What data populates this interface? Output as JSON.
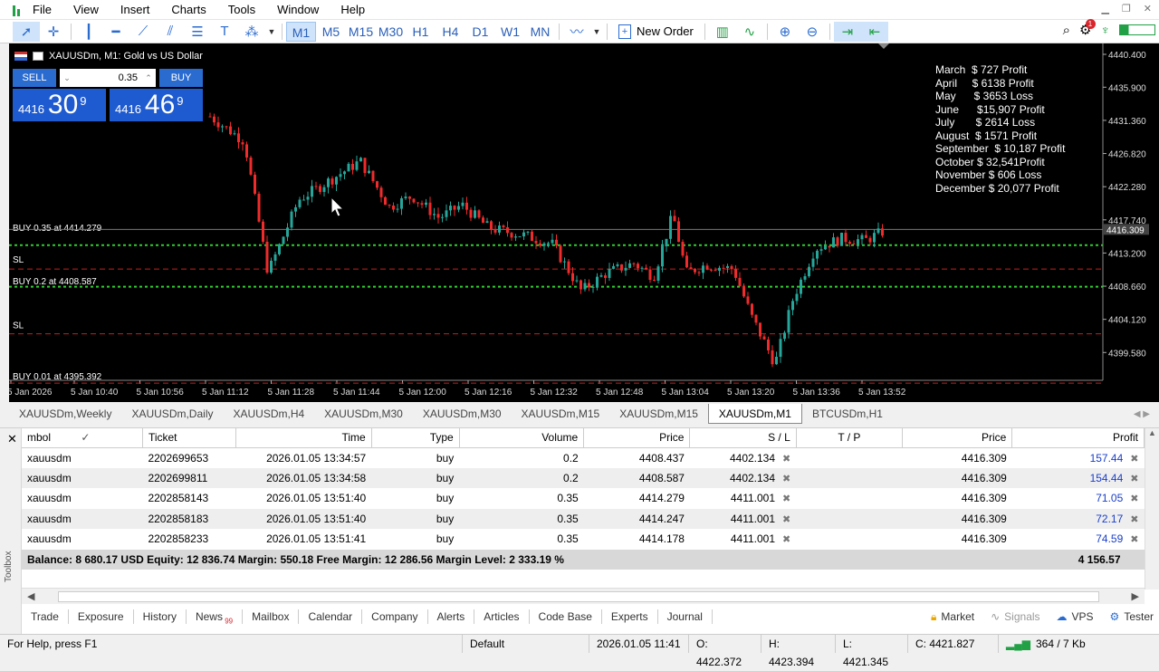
{
  "menu": [
    "File",
    "View",
    "Insert",
    "Charts",
    "Tools",
    "Window",
    "Help"
  ],
  "toolbar": {
    "timeframes": [
      "M1",
      "M5",
      "M15",
      "M30",
      "H1",
      "H4",
      "D1",
      "W1",
      "MN"
    ],
    "active_timeframe": "M1",
    "new_order": "New Order",
    "notification_count": "1"
  },
  "chart": {
    "title": "XAUUSDm, M1:  Gold vs US Dollar",
    "sell_label": "SELL",
    "buy_label": "BUY",
    "volume": "0.35",
    "bid_prefix": "4416",
    "bid_big": "30",
    "bid_sup": "9",
    "ask_prefix": "4416",
    "ask_big": "46",
    "ask_sup": "9",
    "price_axis": [
      "4440.400",
      "4435.900",
      "4431.360",
      "4426.820",
      "4422.280",
      "4417.740",
      "4413.200",
      "4408.660",
      "4404.120",
      "4399.580"
    ],
    "current_price": "4416.309",
    "time_axis": [
      "5 Jan 2026",
      "5 Jan 10:40",
      "5 Jan 10:56",
      "5 Jan 11:12",
      "5 Jan 11:28",
      "5 Jan 11:44",
      "5 Jan 12:00",
      "5 Jan 12:16",
      "5 Jan 12:32",
      "5 Jan 12:48",
      "5 Jan 13:04",
      "5 Jan 13:20",
      "5 Jan 13:36",
      "5 Jan 13:52"
    ],
    "line_labels": [
      "BUY 0.35 at 4414.279",
      "SL",
      "BUY 0.2 at 4408.587",
      "SL",
      "BUY 0.01 at 4395.392"
    ],
    "profit_notes": [
      "March  $ 727 Profit",
      "April     $ 6138 Profit",
      "May      $ 3653 Loss",
      "June      $15,907 Profit",
      "July       $ 2614 Loss",
      "August  $ 1571 Profit",
      "September  $ 10,187 Profit",
      "October $ 32,541Profit",
      "November $ 606 Loss",
      "December $ 20,077 Profit"
    ]
  },
  "chart_tabs": [
    "XAUUSDm,Weekly",
    "XAUUSDm,Daily",
    "XAUUSDm,H4",
    "XAUUSDm,M30",
    "XAUUSDm,M30",
    "XAUUSDm,M15",
    "XAUUSDm,M15",
    "XAUUSDm,M1",
    "BTCUSDm,H1"
  ],
  "active_chart_tab": 7,
  "positions": {
    "headers": [
      "mbol",
      "Ticket",
      "Time",
      "Type",
      "Volume",
      "Price",
      "S / L",
      "T / P",
      "Price",
      "Profit"
    ],
    "rows": [
      [
        "xauusdm",
        "2202699653",
        "2026.01.05 13:34:57",
        "buy",
        "0.2",
        "4408.437",
        "4402.134",
        "",
        "4416.309",
        "157.44"
      ],
      [
        "xauusdm",
        "2202699811",
        "2026.01.05 13:34:58",
        "buy",
        "0.2",
        "4408.587",
        "4402.134",
        "",
        "4416.309",
        "154.44"
      ],
      [
        "xauusdm",
        "2202858143",
        "2026.01.05 13:51:40",
        "buy",
        "0.35",
        "4414.279",
        "4411.001",
        "",
        "4416.309",
        "71.05"
      ],
      [
        "xauusdm",
        "2202858183",
        "2026.01.05 13:51:40",
        "buy",
        "0.35",
        "4414.247",
        "4411.001",
        "",
        "4416.309",
        "72.17"
      ],
      [
        "xauusdm",
        "2202858233",
        "2026.01.05 13:51:41",
        "buy",
        "0.35",
        "4414.178",
        "4411.001",
        "",
        "4416.309",
        "74.59"
      ]
    ],
    "summary": "Balance: 8 680.17 USD  Equity: 12 836.74  Margin: 550.18  Free Margin: 12 286.56  Margin Level: 2 333.19 %",
    "summary_profit": "4 156.57"
  },
  "toolbox_label": "Toolbox",
  "bottom_tabs": [
    "Trade",
    "Exposure",
    "History",
    "News",
    "Mailbox",
    "Calendar",
    "Company",
    "Alerts",
    "Articles",
    "Code Base",
    "Experts",
    "Journal"
  ],
  "news_count": "99",
  "bottom_right": [
    "Market",
    "Signals",
    "VPS",
    "Tester"
  ],
  "status": {
    "help": "For Help, press F1",
    "profile": "Default",
    "datetime": "2026.01.05 11:41",
    "open": "O: 4422.372",
    "high": "H: 4423.394",
    "low": "L: 4421.345",
    "close": "C: 4421.827",
    "traffic": "364 / 7 Kb"
  },
  "colors": {
    "bull": "#26a69a",
    "bear": "#ef2b2b",
    "accent": "#2a6bd0",
    "order_line": "#2fd02f",
    "sl_line": "#c81e1e"
  }
}
